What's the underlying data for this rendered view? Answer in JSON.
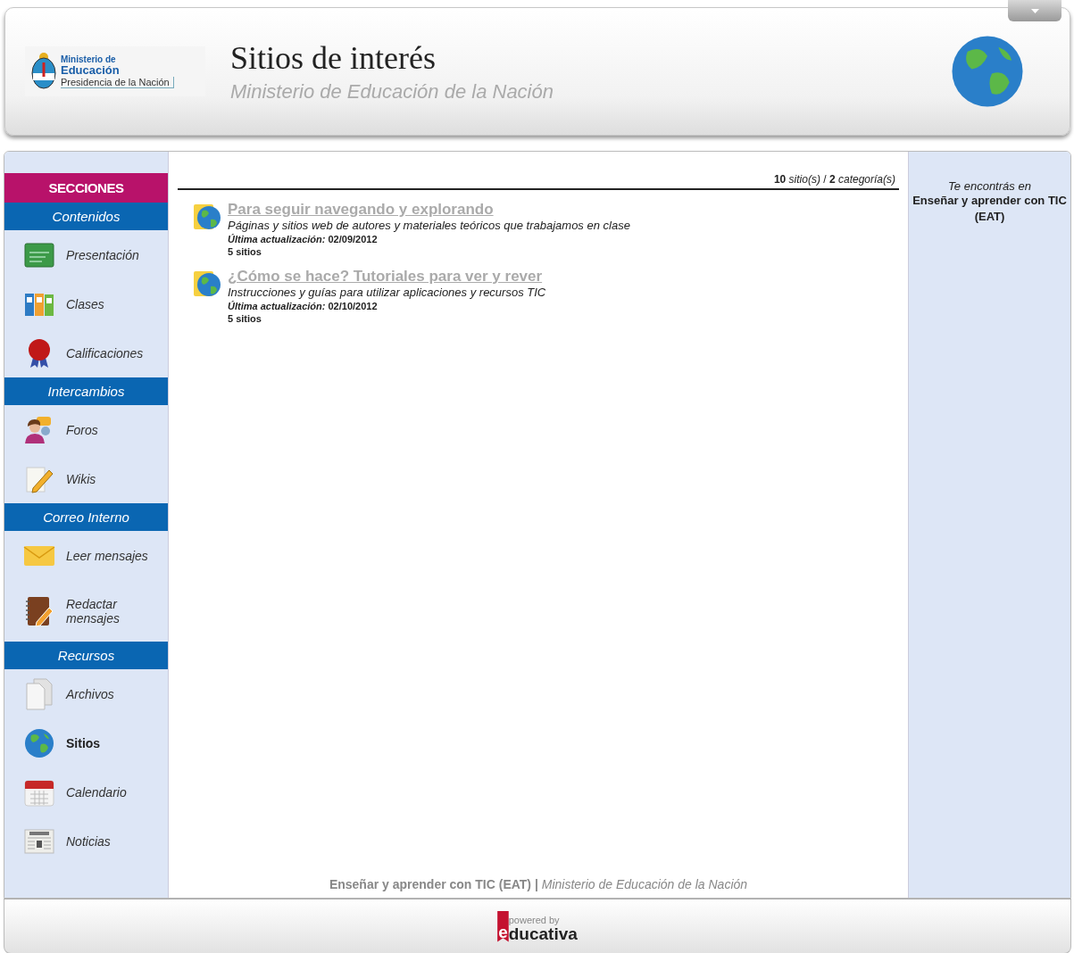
{
  "header": {
    "logo": {
      "line1": "Ministerio de",
      "line2": "Educación",
      "line3": "Presidencia de la Nación"
    },
    "title": "Sitios de interés",
    "subtitle": "Ministerio de Educación de la Nación"
  },
  "sidebar": {
    "title": "SECCIONES",
    "sections": [
      {
        "label": "Contenidos",
        "items": [
          {
            "label": "Presentación",
            "selected": false
          },
          {
            "label": "Clases",
            "selected": false
          },
          {
            "label": "Calificaciones",
            "selected": false
          }
        ]
      },
      {
        "label": "Intercambios",
        "items": [
          {
            "label": "Foros",
            "selected": false
          },
          {
            "label": "Wikis",
            "selected": false
          }
        ]
      },
      {
        "label": "Correo Interno",
        "items": [
          {
            "label": "Leer mensajes",
            "selected": false
          },
          {
            "label": "Redactar mensajes",
            "selected": false
          }
        ]
      },
      {
        "label": "Recursos",
        "items": [
          {
            "label": "Archivos",
            "selected": false
          },
          {
            "label": "Sitios",
            "selected": true
          },
          {
            "label": "Calendario",
            "selected": false
          },
          {
            "label": "Noticias",
            "selected": false
          }
        ]
      }
    ]
  },
  "summary": "**10** *sitio(s)* / **2** *categoría(s)*",
  "categories": [
    {
      "title": "Para seguir navegando y explorando ",
      "description": "Páginas y sitios web de autores y materiales teóricos que trabajamos en clase",
      "updated": "*Última actualización:* 02/09/2012",
      "count": "5 sitios"
    },
    {
      "title": "¿Cómo se hace? Tutoriales para ver y rever ",
      "description": "Instrucciones y guías para utilizar aplicaciones y recursos TIC",
      "updated": "*Última actualización:* 02/10/2012",
      "count": "5 sitios"
    }
  ],
  "location": {
    "label": "Te encontrás en",
    "course": "Enseñar y aprender con TIC (EAT)"
  },
  "footer_text": "**Enseñar y aprender con TIC (EAT) |** *Ministerio de Educación de la Nación*",
  "powered": {
    "tagline": "powered by",
    "mark": "e",
    "name": "ducativa"
  }
}
